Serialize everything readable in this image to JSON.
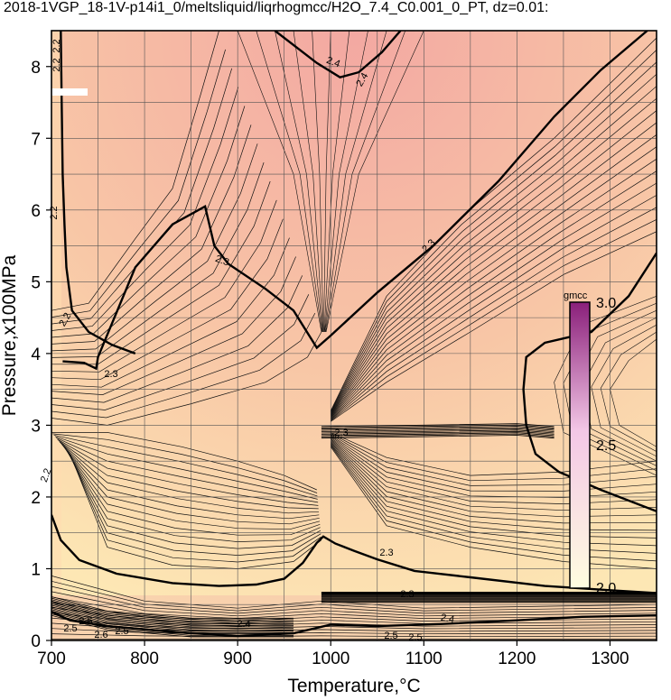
{
  "title": "2018-1VGP_18-1V-p14i1_0/meltsliquid/liqrhogmcc/H2O_7.4_C0.001_0_PT, dz=0.01:",
  "colors": {
    "background_low": "#fde7b4",
    "background_mid": "#f8c6a6",
    "background_high": "#f3a8a2",
    "grid": "#555555",
    "contour": "#000000",
    "colorbar_top": "#8a1f7a",
    "colorbar_mid": "#f3c7e6",
    "colorbar_bottom": "#fffde0"
  },
  "chart_data": {
    "type": "heatmap",
    "title": "2018-1VGP_18-1V-p14i1_0/meltsliquid/liqrhogmcc/H2O_7.4_C0.001_0_PT, dz=0.01:",
    "xlabel": "Temperature,°C",
    "ylabel": "Pressure,x100MPa",
    "xlim": [
      700,
      1350
    ],
    "ylim": [
      0,
      8.5
    ],
    "xticks": [
      "700",
      "800",
      "900",
      "1000",
      "1100",
      "1200",
      "1300"
    ],
    "yticks": [
      "0",
      "1",
      "2",
      "3",
      "4",
      "5",
      "6",
      "7",
      "8"
    ],
    "grid": true,
    "colorbar": {
      "label": "gmcc",
      "min_label": "2.0",
      "mid_label": "2.5",
      "max_label": "3.0",
      "range": [
        2.0,
        3.0
      ]
    },
    "major_contours": [
      {
        "level": 2.3,
        "points": [
          [
            712,
            3.89
          ],
          [
            735,
            3.87
          ],
          [
            748,
            3.79
          ],
          [
            750,
            3.95
          ],
          [
            790,
            5.2
          ],
          [
            830,
            5.8
          ],
          [
            865,
            6.05
          ],
          [
            875,
            5.5
          ],
          [
            890,
            5.25
          ],
          [
            930,
            4.9
          ],
          [
            960,
            4.6
          ],
          [
            985,
            4.08
          ],
          [
            1000,
            4.25
          ],
          [
            1050,
            4.85
          ],
          [
            1110,
            5.5
          ],
          [
            1180,
            6.4
          ],
          [
            1240,
            7.3
          ],
          [
            1290,
            7.95
          ],
          [
            1340,
            8.5
          ]
        ]
      },
      {
        "level": 2.3,
        "points": [
          [
            700,
            1.75
          ],
          [
            710,
            1.4
          ],
          [
            730,
            1.12
          ],
          [
            770,
            0.93
          ],
          [
            830,
            0.8
          ],
          [
            880,
            0.76
          ],
          [
            920,
            0.78
          ],
          [
            950,
            0.86
          ],
          [
            970,
            1.08
          ],
          [
            985,
            1.36
          ],
          [
            992,
            1.45
          ],
          [
            1005,
            1.35
          ],
          [
            1025,
            1.25
          ],
          [
            1050,
            1.13
          ],
          [
            1090,
            0.97
          ],
          [
            1150,
            0.88
          ],
          [
            1230,
            0.76
          ],
          [
            1300,
            0.7
          ],
          [
            1350,
            0.66
          ]
        ]
      },
      {
        "level": 2.4,
        "points": [
          [
            940,
            8.5
          ],
          [
            985,
            8.05
          ],
          [
            1010,
            7.85
          ],
          [
            1030,
            7.92
          ],
          [
            1055,
            8.2
          ],
          [
            1075,
            8.5
          ]
        ]
      },
      {
        "level": 2.4,
        "points": [
          [
            700,
            0.4
          ],
          [
            720,
            0.28
          ],
          [
            760,
            0.2
          ],
          [
            830,
            0.12
          ],
          [
            900,
            0.06
          ],
          [
            960,
            0.1
          ],
          [
            1000,
            0.22
          ],
          [
            1050,
            0.2
          ],
          [
            1120,
            0.23
          ],
          [
            1200,
            0.28
          ],
          [
            1270,
            0.33
          ],
          [
            1350,
            0.35
          ]
        ]
      },
      {
        "level": 2.2,
        "points": [
          [
            710,
            8.5
          ],
          [
            711,
            7.5
          ],
          [
            712,
            6.5
          ],
          [
            714,
            5.8
          ],
          [
            716,
            5.2
          ],
          [
            722,
            4.6
          ],
          [
            740,
            4.3
          ],
          [
            765,
            4.12
          ],
          [
            790,
            4.0
          ]
        ]
      },
      {
        "level": 2.2,
        "points": [
          [
            1350,
            5.4
          ],
          [
            1320,
            4.8
          ],
          [
            1280,
            4.3
          ],
          [
            1230,
            4.15
          ],
          [
            1210,
            3.95
          ],
          [
            1207,
            3.5
          ],
          [
            1210,
            3.0
          ],
          [
            1220,
            2.6
          ],
          [
            1245,
            2.35
          ],
          [
            1290,
            2.1
          ],
          [
            1330,
            1.9
          ],
          [
            1350,
            1.8
          ]
        ]
      }
    ],
    "contour_labels": [
      "2.2",
      "2.2",
      "2.2",
      "2.2",
      "2.2",
      "2.3",
      "2.3",
      "2.3",
      "2.3",
      "2.3",
      "2.3",
      "2.4",
      "2.4",
      "2.4",
      "2.4",
      "2.5",
      "2.5",
      "2.5",
      "2.5",
      "2.5",
      "2.6"
    ]
  }
}
